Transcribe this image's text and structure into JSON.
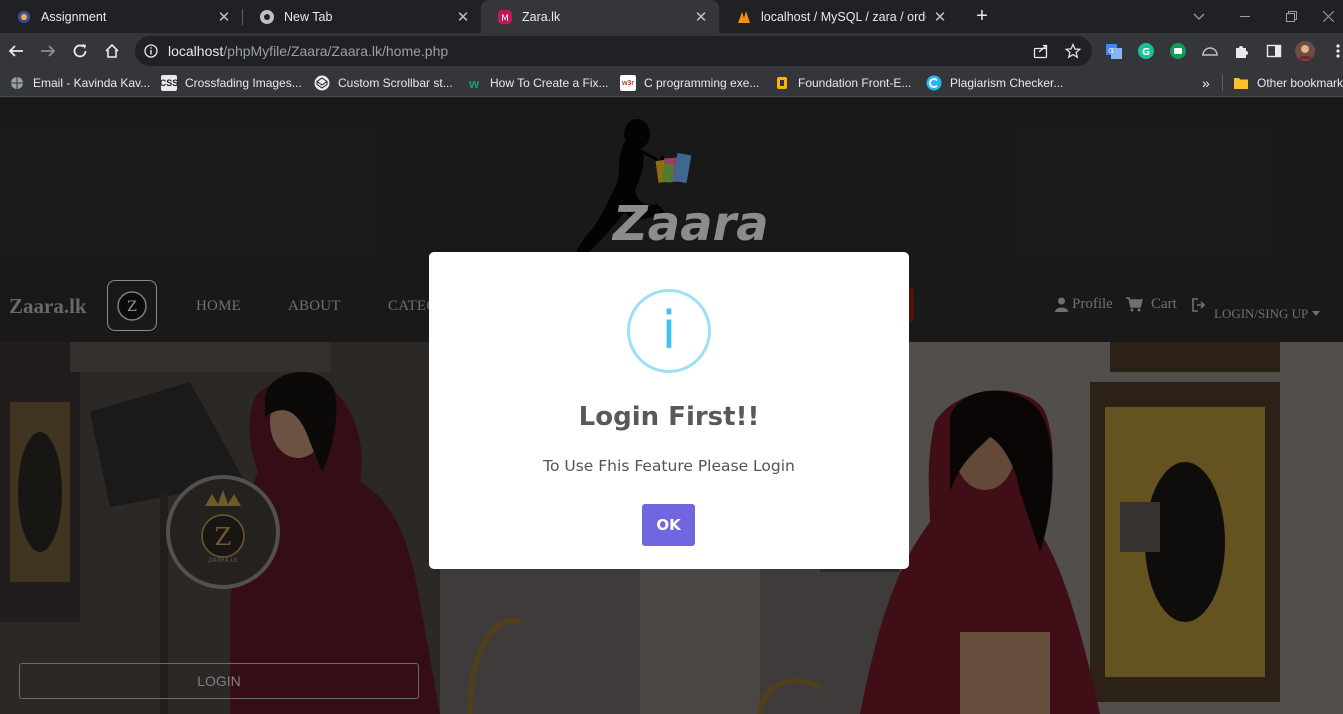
{
  "browser": {
    "tabs": [
      {
        "label": "Assignment",
        "icon": "assignment-favicon",
        "active": false
      },
      {
        "label": "New Tab",
        "icon": "chrome-favicon",
        "active": false
      },
      {
        "label": "Zara.lk",
        "icon": "zara-favicon",
        "active": true
      },
      {
        "label": "localhost / MySQL / zara / order_",
        "icon": "phpmyadmin-favicon",
        "active": false
      }
    ],
    "new_tab": "+",
    "address": {
      "host": "localhost",
      "path": "/phpMyfile/Zaara/Zaara.lk/home.php"
    },
    "bookmarks": [
      {
        "label": "Email - Kavinda Kav...",
        "icon": "globe-icon"
      },
      {
        "label": "Crossfading Images...",
        "icon": "css-icon"
      },
      {
        "label": "Custom Scrollbar st...",
        "icon": "codepen-icon"
      },
      {
        "label": "How To Create a Fix...",
        "icon": "w3schools-icon"
      },
      {
        "label": "C programming exe...",
        "icon": "w3r-icon"
      },
      {
        "label": "Foundation Front-E...",
        "icon": "foundation-icon"
      },
      {
        "label": "Plagiarism Checker...",
        "icon": "plagiarism-icon"
      }
    ],
    "bookmarks_more": "»",
    "other_bookmarks": "Other bookmarks",
    "colors": {
      "tabstrip": "#202124",
      "toolbar": "#35363a"
    }
  },
  "site": {
    "logo_text": "Zaara",
    "brand": "Zaara.lk",
    "nav": [
      "HOME",
      "ABOUT",
      "CATEG"
    ],
    "profile": "Profile",
    "cart": "Cart",
    "login_signup": "LOGIN/SING UP",
    "hero_login": "LOGIN",
    "badge_letter": "Z",
    "badge_caption": "ZAARA.LK"
  },
  "modal": {
    "icon": "info-icon",
    "icon_glyph": "i",
    "title": "Login First!!",
    "text": "To Use Fhis Feature Please Login",
    "ok": "OK",
    "colors": {
      "button": "#7066e0",
      "icon": "#3fc3ee"
    }
  }
}
